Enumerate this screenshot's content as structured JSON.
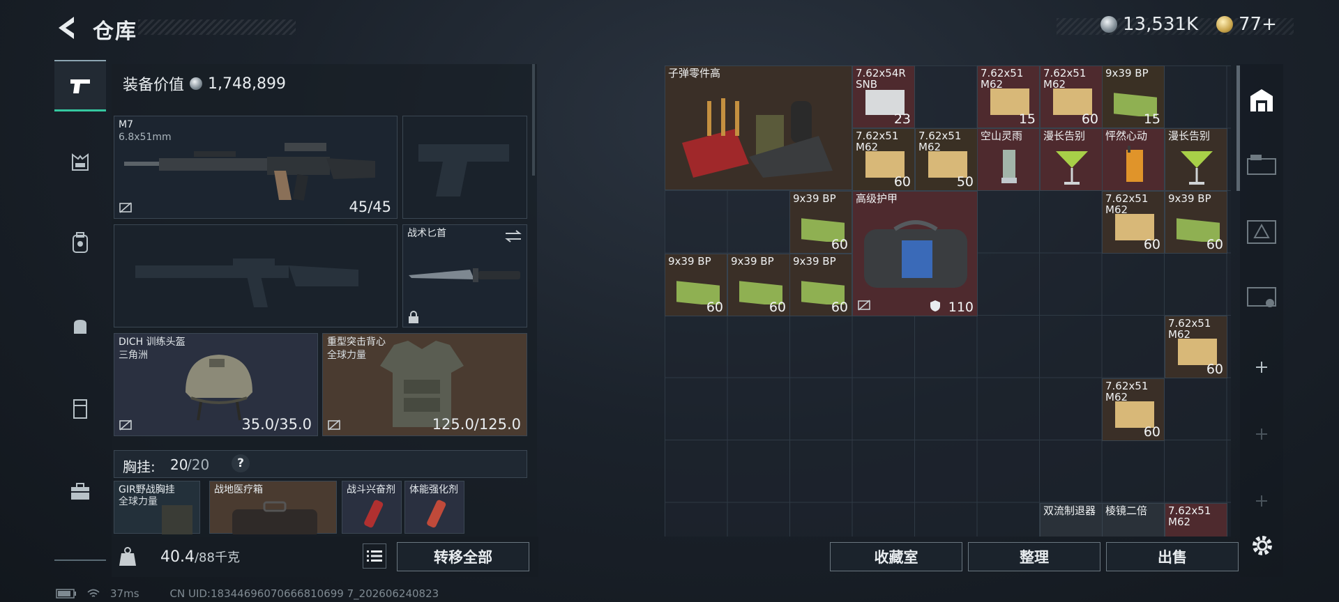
{
  "header": {
    "title": "仓库",
    "silver": "13,531K",
    "gold": "77+"
  },
  "loadout": {
    "equip_value_label": "装备价值",
    "equip_value": "1,748,899",
    "primary": {
      "name": "M7",
      "caliber": "6.8x51mm",
      "ammo": "45/45"
    },
    "knife": {
      "name": "战术匕首"
    },
    "helmet": {
      "name": "DICH 训练头盔",
      "brand": "三角洲",
      "durability": "35.0/35.0"
    },
    "armor": {
      "name": "重型突击背心",
      "brand": "全球力量",
      "durability": "125.0/125.0"
    },
    "chest_rig": {
      "label": "胸挂:",
      "used": "20",
      "total": "/20",
      "help": "?"
    },
    "rig_items": [
      {
        "name": "GIR野战胸挂",
        "sub": "全球力量"
      },
      {
        "name": "战地医疗箱",
        "sub": ""
      },
      {
        "name": "战斗兴奋剂",
        "sub": ""
      },
      {
        "name": "体能强化剂",
        "sub": ""
      }
    ],
    "weight": "40.4",
    "weight_max": "/88千克",
    "transfer_all": "转移全部"
  },
  "stash": {
    "items": [
      {
        "name": "子弹零件高",
        "count": ""
      },
      {
        "name": "7.62x54R SNB",
        "count": "23"
      },
      {
        "name": "7.62x51 M62",
        "count": "15"
      },
      {
        "name": "7.62x51 M62",
        "count": "60"
      },
      {
        "name": "9x39 BP",
        "count": "15"
      },
      {
        "name": "7.62x51 M62",
        "count": "60"
      },
      {
        "name": "7.62x51 M62",
        "count": "50"
      },
      {
        "name": "空山灵雨",
        "count": ""
      },
      {
        "name": "漫长告别",
        "count": ""
      },
      {
        "name": "怦然心动",
        "count": ""
      },
      {
        "name": "漫长告别",
        "count": ""
      },
      {
        "name": "9x39 BP",
        "count": "60"
      },
      {
        "name": "高级护甲",
        "count": "110"
      },
      {
        "name": "7.62x51 M62",
        "count": "60"
      },
      {
        "name": "9x39 BP",
        "count": "60"
      },
      {
        "name": "9x39 BP",
        "count": "60"
      },
      {
        "name": "9x39 BP",
        "count": "60"
      },
      {
        "name": "9x39 BP",
        "count": "60"
      },
      {
        "name": "7.62x51 M62",
        "count": "60"
      },
      {
        "name": "7.62x51 M62",
        "count": "60"
      },
      {
        "name": "双流制退器",
        "count": ""
      },
      {
        "name": "棱镜二倍",
        "count": ""
      },
      {
        "name": "7.62x51 M62",
        "count": ""
      }
    ]
  },
  "actions": {
    "collection": "收藏室",
    "organize": "整理",
    "sell": "出售"
  },
  "status": {
    "ping": "37ms",
    "uid": "CN UID:18344696070666810699 7_202606240823"
  }
}
